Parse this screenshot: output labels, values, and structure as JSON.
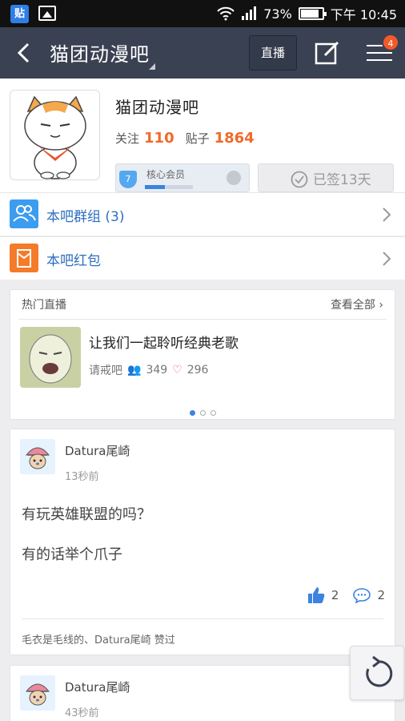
{
  "status_bar": {
    "app_icon_label": "贴",
    "battery": "73%",
    "time": "下午 10:45"
  },
  "nav": {
    "title": "猫团动漫吧",
    "live_button": "直播",
    "menu_badge": "4"
  },
  "forum": {
    "name": "猫团动漫吧",
    "follow_label": "关注",
    "follow_count": "110",
    "posts_label": "贴子",
    "posts_count": "1864",
    "member_level": "7",
    "member_label": "核心会员",
    "member_progress": 0.42,
    "signed_label": "已签13天"
  },
  "rows": [
    {
      "label": "本吧群组 (3)",
      "icon": "group-icon",
      "color": "#3b9cf0"
    },
    {
      "label": "本吧红包",
      "icon": "red-envelope-icon",
      "color": "#f47b2a"
    }
  ],
  "hot_live": {
    "title": "热门直播",
    "see_all": "查看全部",
    "item": {
      "name": "让我们一起聆听经典老歌",
      "host": "请戒吧",
      "viewers": "349",
      "likes": "296"
    }
  },
  "posts": [
    {
      "user": "Datura尾崎",
      "time": "13秒前",
      "lines": [
        "有玩英雄联盟的吗？",
        "有的话举个爪子"
      ],
      "likes": "2",
      "comments": "2",
      "liked_by": "毛衣是毛线的、Datura尾崎 赞过"
    },
    {
      "user": "Datura尾崎",
      "time": "43秒前"
    }
  ],
  "colors": {
    "nav_bg": "#3a4152",
    "accent_blue": "#3b83e0",
    "count_orange": "#f06a2a"
  }
}
